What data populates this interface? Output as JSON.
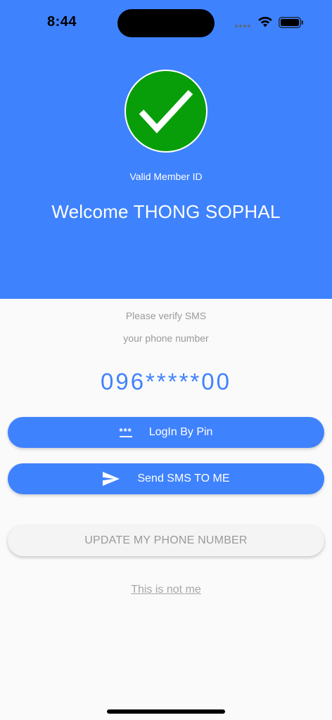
{
  "status_bar": {
    "time": "8:44",
    "icons": [
      "signal-dots-icon",
      "wifi-icon",
      "battery-icon"
    ]
  },
  "header": {
    "badge_icon": "check-icon",
    "badge_color": "#089e0a",
    "background_color": "#3f82fd",
    "valid_label": "Valid Member ID",
    "welcome_text": "Welcome THONG SOPHAL"
  },
  "verify": {
    "line1": "Please verify SMS",
    "line2": "your phone number",
    "phone_masked": "096*****00"
  },
  "actions": {
    "login_pin_icon_glyph": "***",
    "login_pin_label": "LogIn By Pin",
    "send_sms_icon": "send-icon",
    "send_sms_label": "Send SMS TO ME",
    "update_phone_label": "UPDATE MY PHONE NUMBER",
    "not_me_label": "This is not me"
  },
  "colors": {
    "accent": "#3f82fd",
    "muted_text": "#9a9a9a"
  }
}
